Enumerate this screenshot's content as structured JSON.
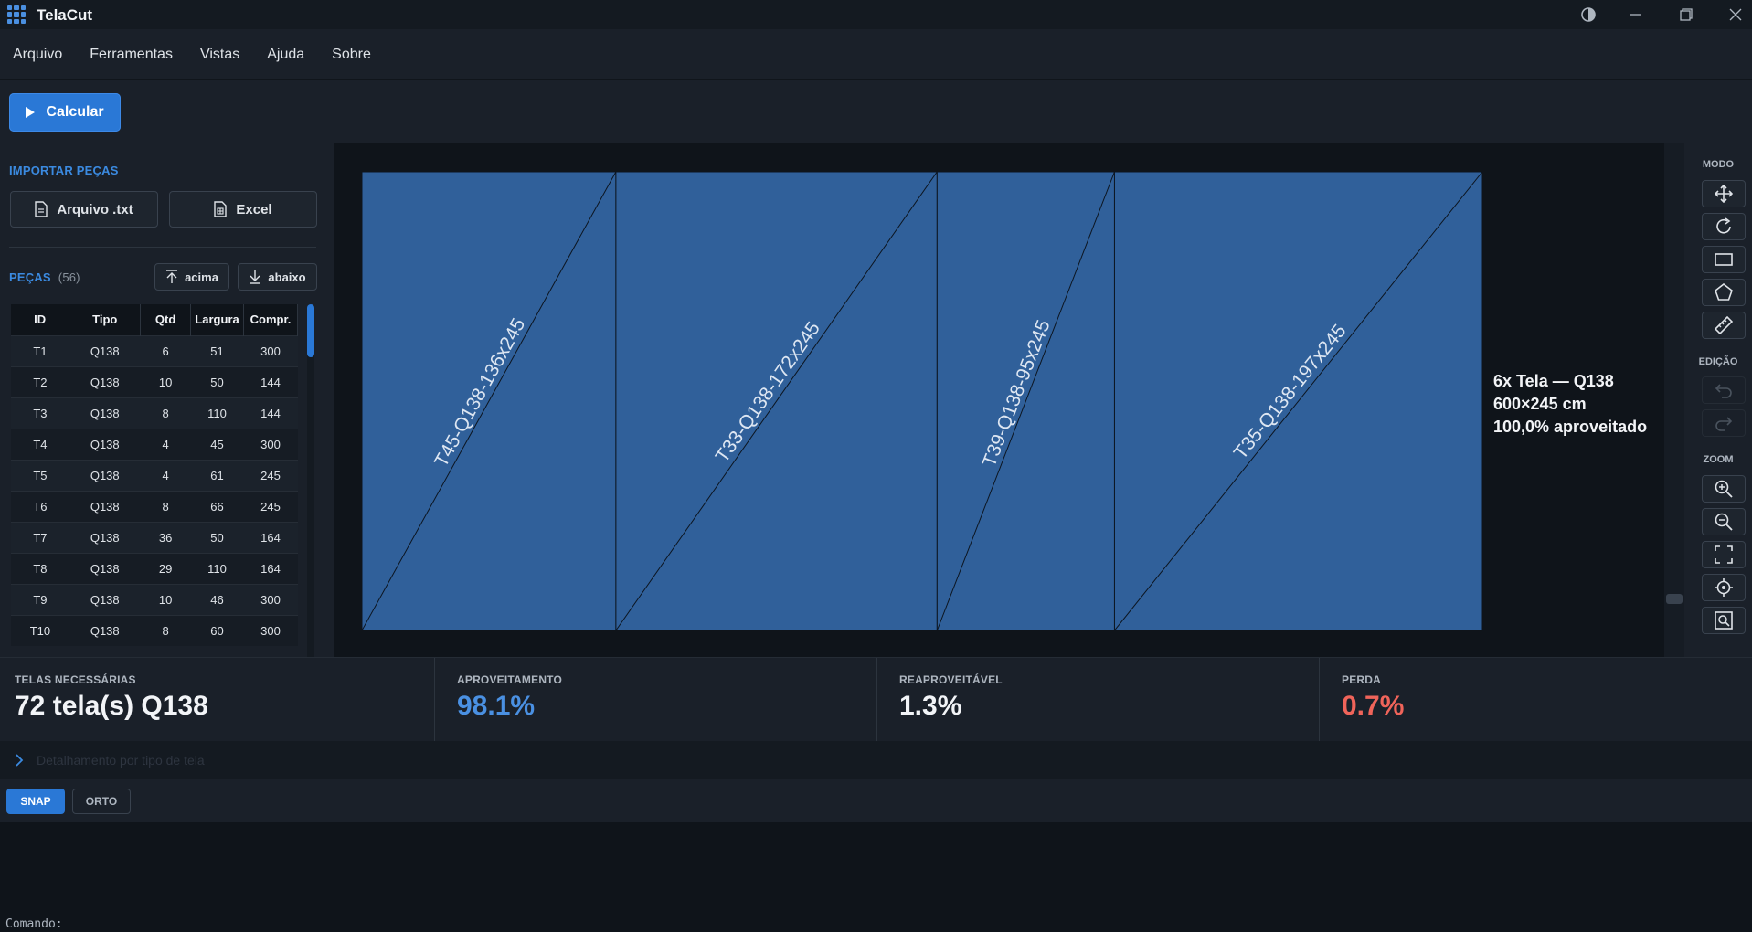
{
  "app": {
    "title": "TelaCut"
  },
  "menu": [
    "Arquivo",
    "Ferramentas",
    "Vistas",
    "Ajuda",
    "Sobre"
  ],
  "toolbar": {
    "calc_label": "Calcular"
  },
  "import": {
    "title": "IMPORTAR PEÇAS",
    "txt_label": "Arquivo .txt",
    "excel_label": "Excel"
  },
  "pieces": {
    "title": "PEÇAS",
    "count": "(56)",
    "up_label": "acima",
    "down_label": "abaixo",
    "columns": [
      "ID",
      "Tipo",
      "Qtd",
      "Largura",
      "Compr."
    ],
    "rows": [
      [
        "T1",
        "Q138",
        "6",
        "51",
        "300"
      ],
      [
        "T2",
        "Q138",
        "10",
        "50",
        "144"
      ],
      [
        "T3",
        "Q138",
        "8",
        "110",
        "144"
      ],
      [
        "T4",
        "Q138",
        "4",
        "45",
        "300"
      ],
      [
        "T5",
        "Q138",
        "4",
        "61",
        "245"
      ],
      [
        "T6",
        "Q138",
        "8",
        "66",
        "245"
      ],
      [
        "T7",
        "Q138",
        "36",
        "50",
        "164"
      ],
      [
        "T8",
        "Q138",
        "29",
        "110",
        "164"
      ],
      [
        "T9",
        "Q138",
        "10",
        "46",
        "300"
      ],
      [
        "T10",
        "Q138",
        "8",
        "60",
        "300"
      ]
    ]
  },
  "sheet": {
    "width": 600,
    "height": 245,
    "label_line1": "6x  Tela — Q138",
    "label_line2": "600×245 cm",
    "label_line3": "100,0% aproveitado",
    "fill_color": "#30609a",
    "pieces": [
      {
        "label": "T45-Q138-136x245",
        "width": 136
      },
      {
        "label": "T33-Q138-172x245",
        "width": 172
      },
      {
        "label": "T39-Q138-95x245",
        "width": 95
      },
      {
        "label": "T35-Q138-197x245",
        "width": 197
      }
    ]
  },
  "right_panel": {
    "mode_title": "MODO",
    "edit_title": "EDIÇÃO",
    "zoom_title": "ZOOM"
  },
  "stats": {
    "sheets_label": "TELAS NECESSÁRIAS",
    "sheets_value": "72 tela(s) Q138",
    "usage_label": "APROVEITAMENTO",
    "usage_value": "98.1%",
    "reuse_label": "REAPROVEITÁVEL",
    "reuse_value": "1.3%",
    "loss_label": "PERDA",
    "loss_value": "0.7%",
    "colors": {
      "usage": "#4a90e2",
      "loss": "#f0645a",
      "default": "#f2f4f7"
    }
  },
  "details": {
    "label": "Detalhamento por tipo de tela"
  },
  "snap": {
    "snap_label": "SNAP",
    "orto_label": "ORTO"
  },
  "command": {
    "prompt": "Comando:"
  }
}
